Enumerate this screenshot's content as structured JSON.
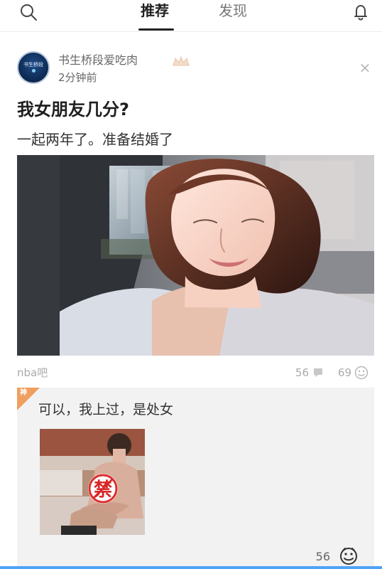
{
  "header": {
    "tabs": [
      {
        "label": "推荐",
        "active": true
      },
      {
        "label": "发现",
        "active": false
      }
    ],
    "left_icon": "search-icon",
    "right_icon": "bell-icon"
  },
  "post": {
    "author": {
      "name": "书生桥段爱吃肉",
      "avatar_text": "书生桥段"
    },
    "time": "2分钟前",
    "title": "我女朋友几分?",
    "body": "一起两年了。准备结婚了",
    "source": "nba吧",
    "comments": "56",
    "likes": "69"
  },
  "featured_comment": {
    "badge": "神",
    "text": "可以，我上过，是处女",
    "likes": "56",
    "prohibited_mark": "禁"
  },
  "colors": {
    "accent": "#ef9f60",
    "muted": "#aaaaaa",
    "bottom_bar": "#4fa3f7"
  }
}
